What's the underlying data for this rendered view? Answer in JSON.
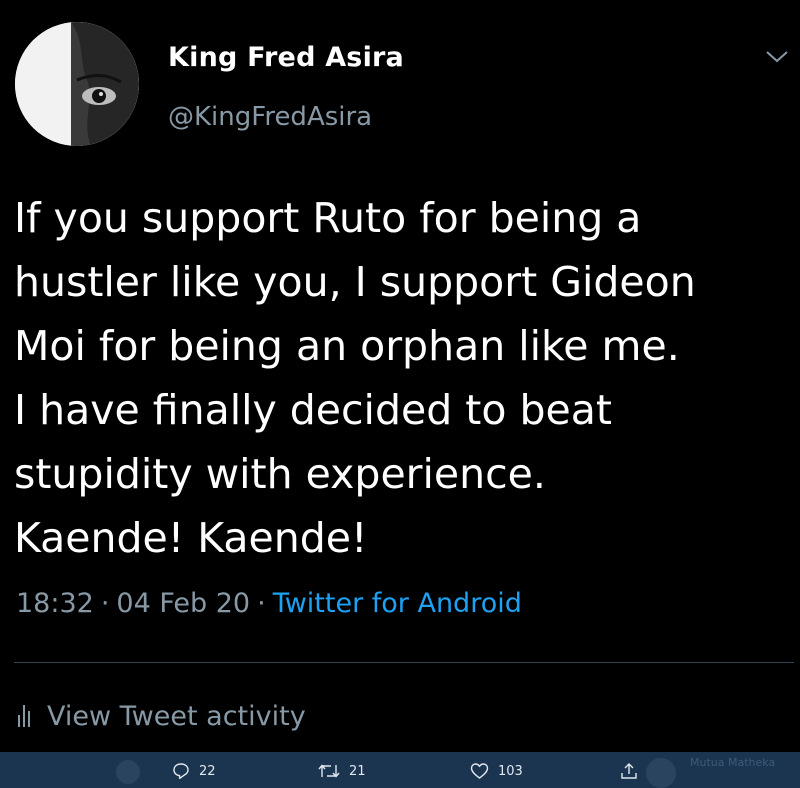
{
  "user": {
    "display_name": "King Fred Asira",
    "handle": "@KingFredAsira"
  },
  "tweet": {
    "lines": [
      "If you support Ruto for being a",
      "hustler like you,  I support Gideon",
      "Moi for being an orphan like me.",
      "I have finally decided to beat",
      "stupidity with experience.",
      "Kaende! Kaende!"
    ],
    "time": "18:32",
    "date": "04 Feb 20",
    "separator": "·",
    "source": "Twitter for Android"
  },
  "activity": {
    "label": "View Tweet activity",
    "icon": "bar-chart-icon"
  },
  "actions": {
    "reply": {
      "icon": "reply-icon",
      "count": "22"
    },
    "retweet": {
      "icon": "retweet-icon",
      "count": "21"
    },
    "like": {
      "icon": "heart-icon",
      "count": "103"
    },
    "share": {
      "icon": "share-icon"
    }
  },
  "background_ghost": {
    "name": "Mutua Matheka"
  },
  "colors": {
    "background": "#000000",
    "text": "#ffffff",
    "secondary": "#8899a6",
    "link": "#1da1f2",
    "action_bar": "#1b3450"
  }
}
